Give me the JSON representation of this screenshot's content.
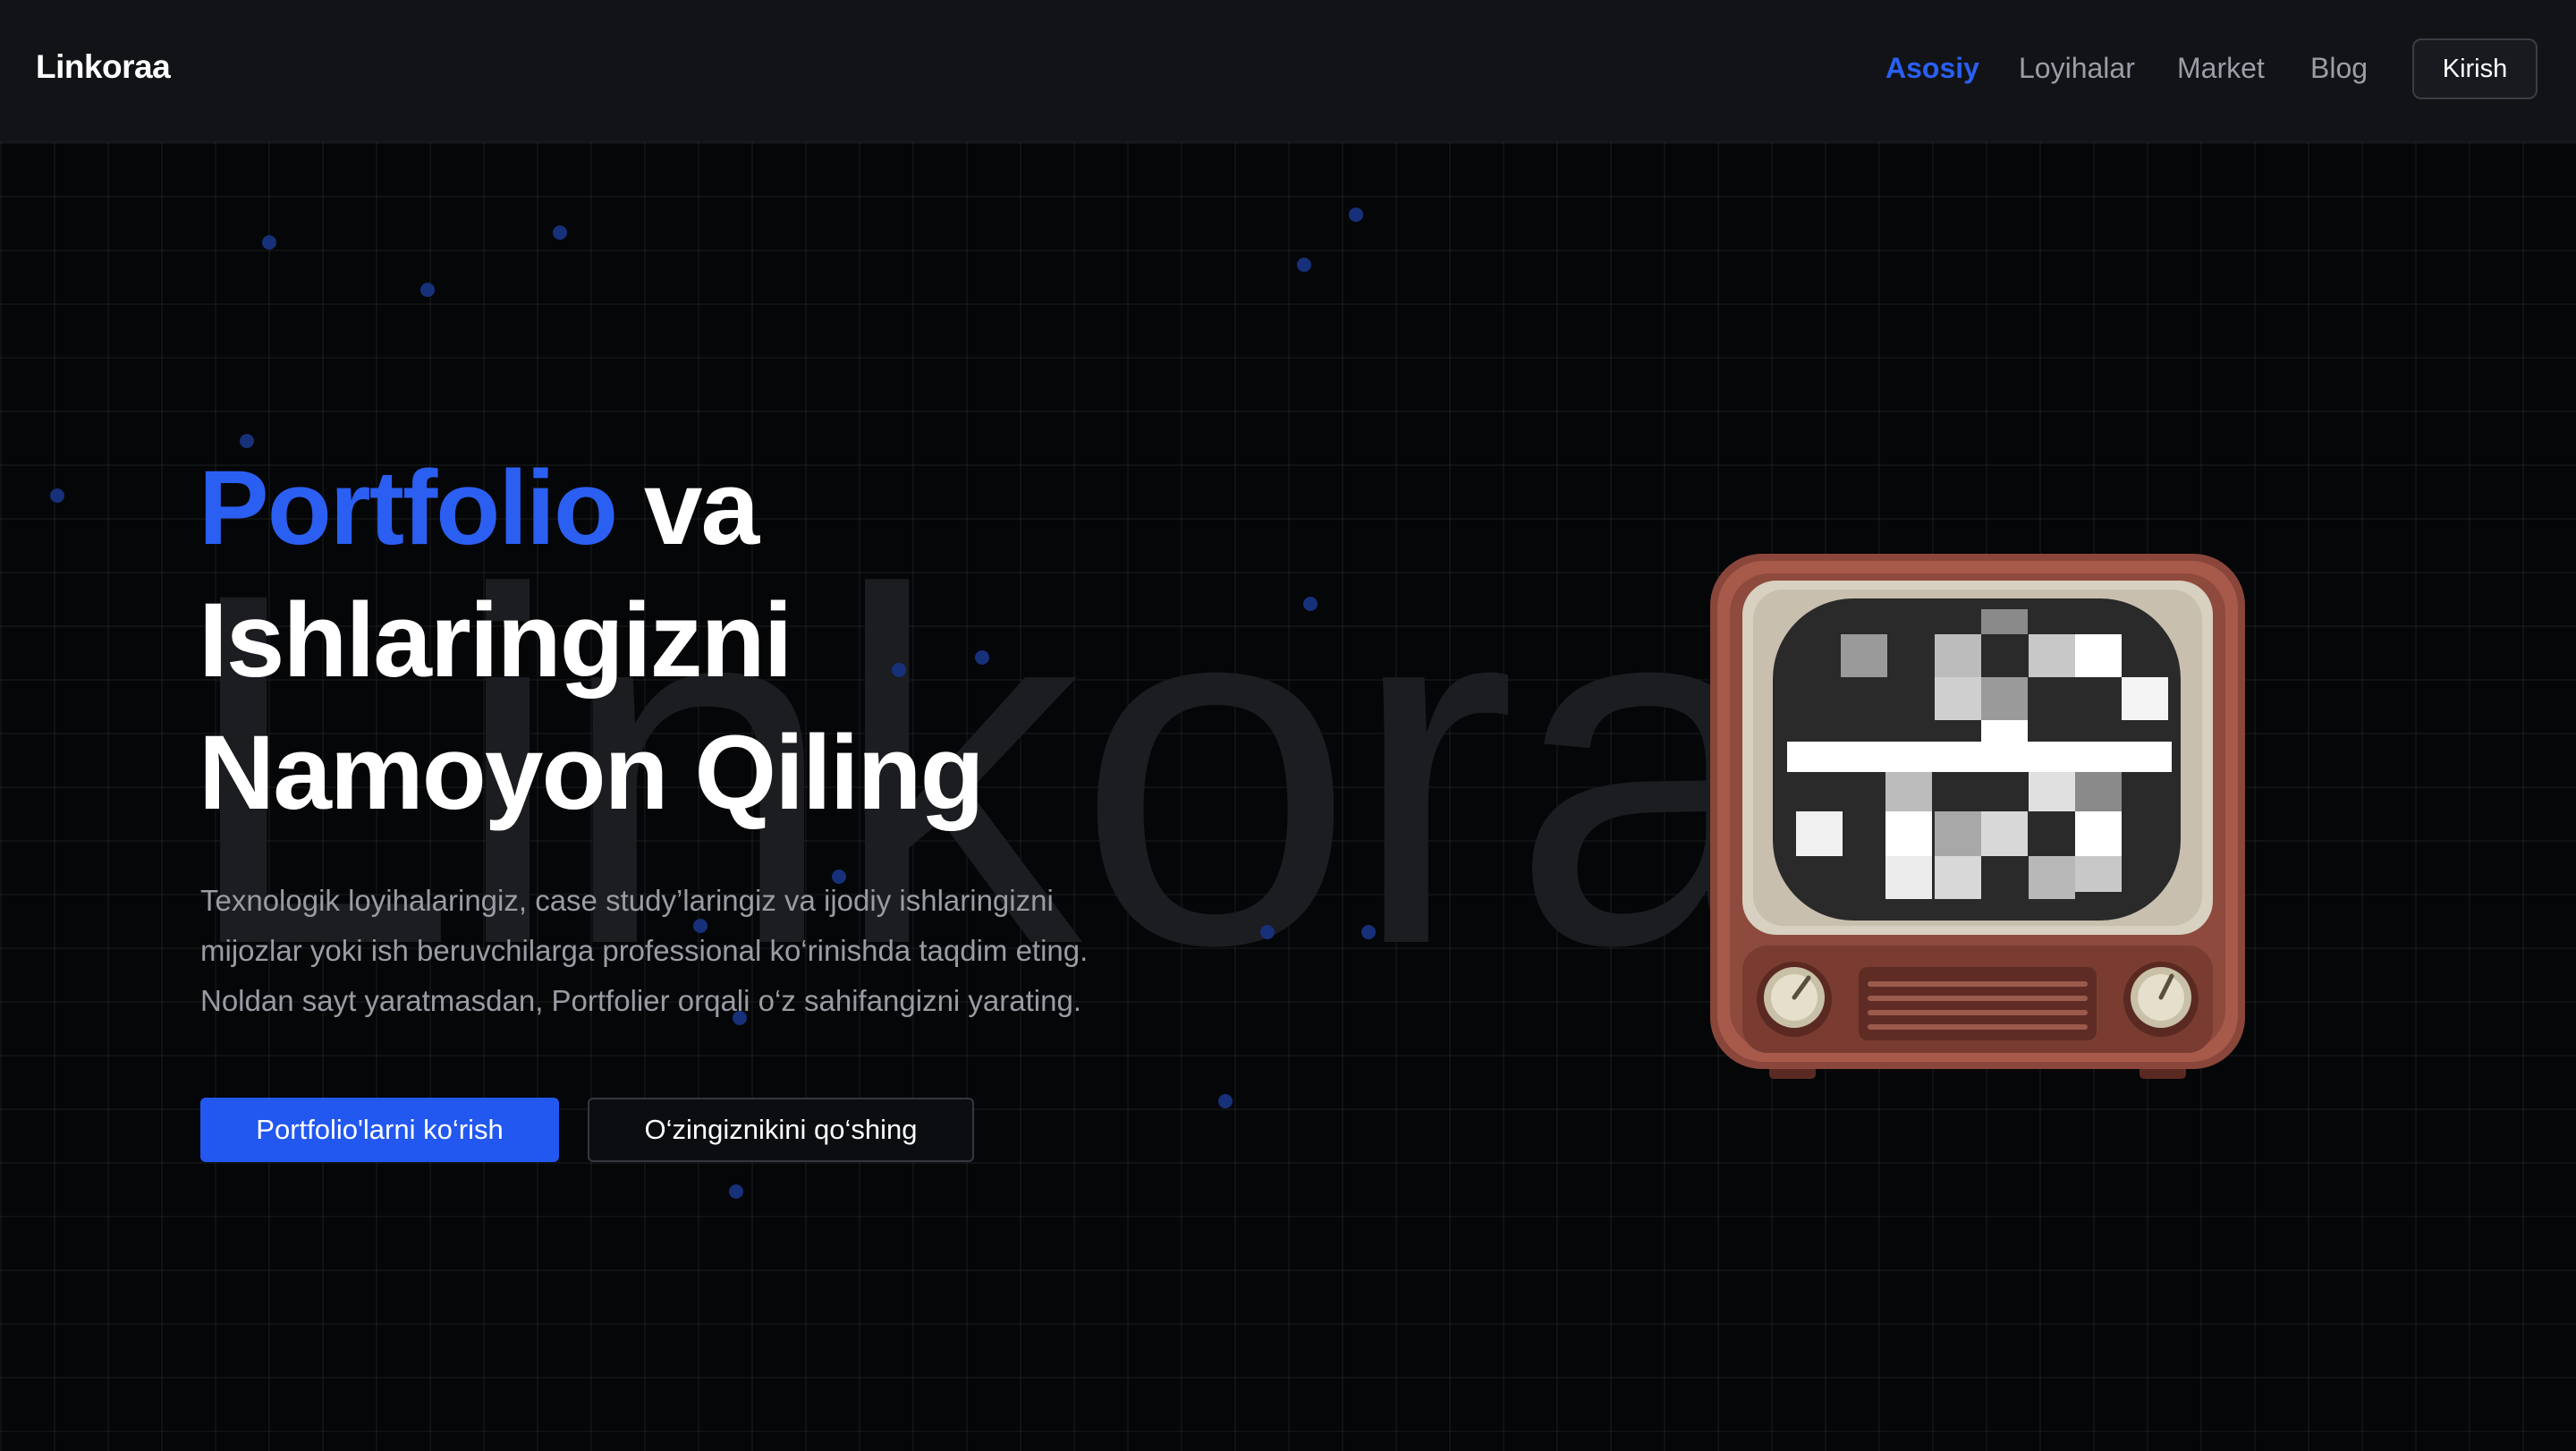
{
  "header": {
    "logo": "Linkoraa",
    "nav": [
      {
        "label": "Asosiy",
        "active": true
      },
      {
        "label": "Loyihalar",
        "active": false
      },
      {
        "label": "Market",
        "active": false
      },
      {
        "label": "Blog",
        "active": false
      }
    ],
    "login_label": "Kirish"
  },
  "hero": {
    "watermark": "Linkoraa",
    "title_accent": "Portfolio",
    "title_rest_1": " va",
    "title_line_2": "Ishlaringizni",
    "title_line_3": "Namoyon Qiling",
    "description": [
      "Texnologik loyihalaringiz, case study’laringiz va ijodiy ishlaringizni",
      "mijozlar yoki ish beruvchilarga professional ko‘rinishda taqdim eting.",
      "Noldan sayt yaratmasdan, Portfolier orqali o‘z sahifangizni yarating."
    ],
    "primary_button": "Portfolio'larni ko‘rish",
    "secondary_button": "O‘zingiznikini qo‘shing",
    "image_icon": "retro-tv-icon"
  },
  "colors": {
    "accent": "#2b5ff2",
    "background": "#050608",
    "header_bg": "#111317",
    "muted_text": "#9a9ca3"
  }
}
